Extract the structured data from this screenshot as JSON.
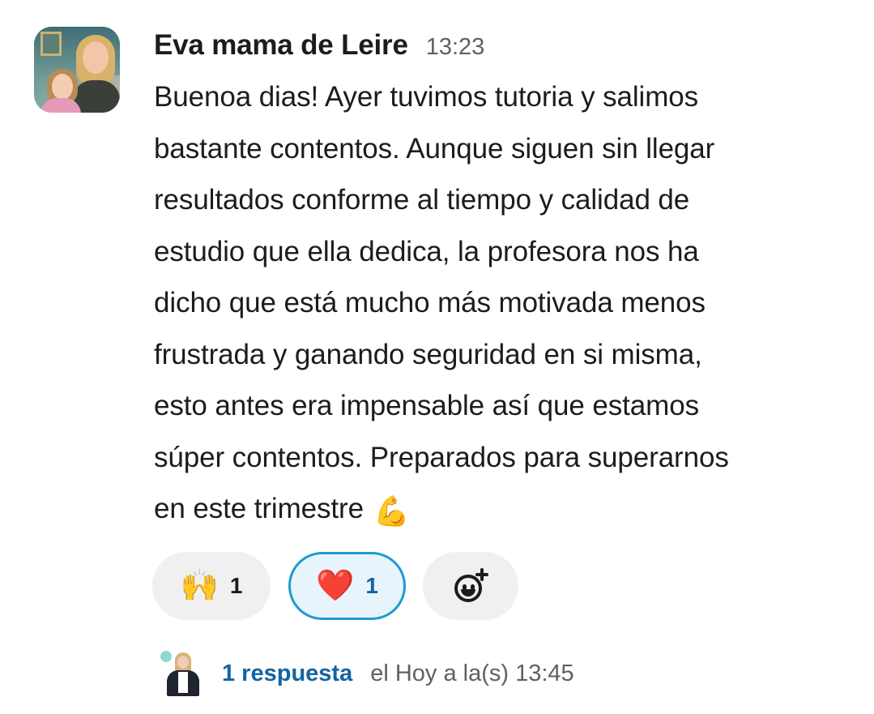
{
  "message": {
    "author": "Eva mama de Leire",
    "time": "13:23",
    "lines": [
      "Buenoa dias! Ayer tuvimos tutoria y salimos",
      "bastante contentos. Aunque siguen sin llegar",
      "resultados conforme al tiempo y calidad de",
      "estudio que ella dedica, la profesora nos ha",
      "dicho que está mucho más motivada  menos",
      "frustrada y ganando seguridad en si misma,",
      "esto antes era impensable así que estamos",
      "súper contentos. Preparados para superarnos",
      "en este trimestre"
    ],
    "trailing_emoji": "💪"
  },
  "reactions": [
    {
      "emoji": "🙌",
      "count": "1",
      "selected": false
    },
    {
      "emoji": "❤️",
      "count": "1",
      "selected": true
    }
  ],
  "add_reaction_icon": "add-emoji-icon",
  "thread": {
    "replies": "1 respuesta",
    "last_reply": "el Hoy a la(s) 13:45"
  },
  "colors": {
    "text": "#1d1c1d",
    "muted": "#616061",
    "link": "#1264a3",
    "selected_border": "#1d9bd1",
    "selected_bg": "#e8f4fb",
    "pill_bg": "#f0f0f0"
  }
}
